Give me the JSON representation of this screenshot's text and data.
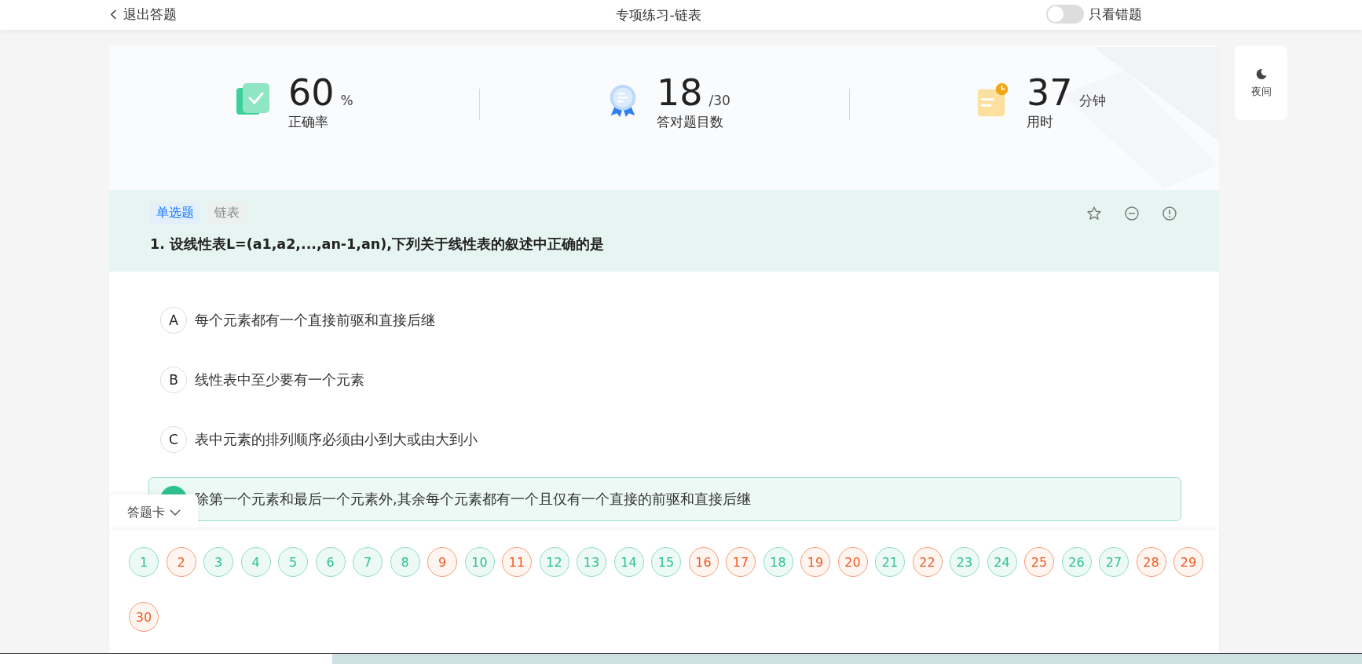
{
  "header": {
    "back": "退出答题",
    "title": "专项练习-链表",
    "wrong_only": {
      "label": "只看错题",
      "on": false
    }
  },
  "stats": [
    {
      "kind": "accuracy",
      "value": "60",
      "unit": "%",
      "label": "正确率"
    },
    {
      "kind": "correct",
      "value": "18",
      "unit": "/30",
      "label": "答对题目数"
    },
    {
      "kind": "time",
      "value": "37",
      "unit": "分钟",
      "label": "用时"
    }
  ],
  "night_button": {
    "label": "夜间"
  },
  "question": {
    "type_tag": "单选题",
    "topic_tag": "链表",
    "text": "1. 设线性表L=(a1,a2,...,an-1,an),下列关于线性表的叙述中正确的是"
  },
  "options": [
    {
      "letter": "A",
      "text": "每个元素都有一个直接前驱和直接后继",
      "selected": false
    },
    {
      "letter": "B",
      "text": "线性表中至少要有一个元素",
      "selected": false
    },
    {
      "letter": "C",
      "text": "表中元素的排列顺序必须由小到大或由大到小",
      "selected": false
    },
    {
      "text": "除第一个元素和最后一个元素外,其余每个元素都有一个且仅有一个直接的前驱和直接后继",
      "selected": true
    }
  ],
  "answer_card": {
    "label": "答题卡",
    "expanded": true,
    "items": [
      {
        "number": "1",
        "correct": true
      },
      {
        "number": "2",
        "correct": false
      },
      {
        "number": "3",
        "correct": true
      },
      {
        "number": "4",
        "correct": true
      },
      {
        "number": "5",
        "correct": true
      },
      {
        "number": "6",
        "correct": true
      },
      {
        "number": "7",
        "correct": true
      },
      {
        "number": "8",
        "correct": true
      },
      {
        "number": "9",
        "correct": false
      },
      {
        "number": "10",
        "correct": true
      },
      {
        "number": "11",
        "correct": false
      },
      {
        "number": "12",
        "correct": true
      },
      {
        "number": "13",
        "correct": true
      },
      {
        "number": "14",
        "correct": true
      },
      {
        "number": "15",
        "correct": true
      },
      {
        "number": "16",
        "correct": false
      },
      {
        "number": "17",
        "correct": false
      },
      {
        "number": "18",
        "correct": true
      },
      {
        "number": "19",
        "correct": false
      },
      {
        "number": "20",
        "correct": false
      },
      {
        "number": "21",
        "correct": true
      },
      {
        "number": "22",
        "correct": false
      },
      {
        "number": "23",
        "correct": true
      },
      {
        "number": "24",
        "correct": true
      },
      {
        "number": "25",
        "correct": false
      },
      {
        "number": "26",
        "correct": true
      },
      {
        "number": "27",
        "correct": true
      },
      {
        "number": "28",
        "correct": false
      },
      {
        "number": "29",
        "correct": false
      },
      {
        "number": "30",
        "correct": false
      }
    ]
  }
}
